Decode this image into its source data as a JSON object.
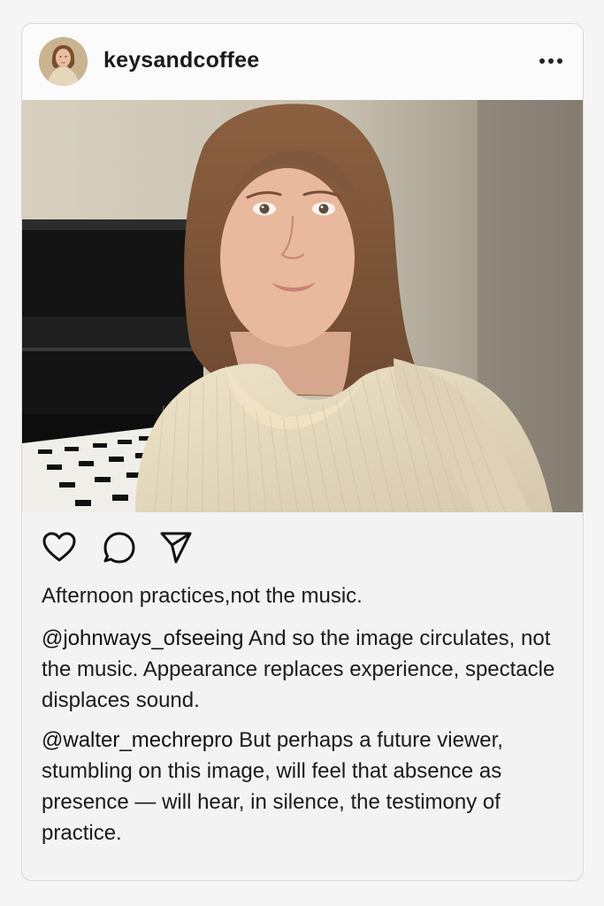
{
  "post": {
    "username": "keysandcoffee",
    "caption": "Afternoon practices,not the music."
  },
  "comments": [
    {
      "handle": "@johnways_ofseeing",
      "text": "And so the image circulates, not the music. Appearance replaces experience, spectacle displaces sound."
    },
    {
      "handle": "@walter_mechrepro",
      "text": "But perhaps a future viewer, stumbling on this image, will feel that absence as presence — will hear, in silence, the testimony of practice."
    }
  ],
  "icons": {
    "avatar": "profile-avatar",
    "more": "more-options-icon",
    "like": "heart-icon",
    "comment": "comment-icon",
    "share": "send-icon"
  },
  "colors": {
    "card_background": "#f3f3f3",
    "header_background": "#fbfbfb",
    "text": "#1b1b1b"
  }
}
